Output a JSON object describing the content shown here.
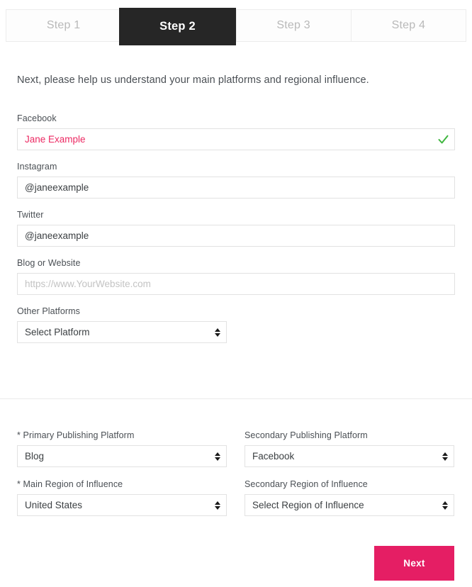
{
  "stepper": {
    "tabs": [
      {
        "label": "Step 1",
        "active": false
      },
      {
        "label": "Step 2",
        "active": true
      },
      {
        "label": "Step 3",
        "active": false
      },
      {
        "label": "Step 4",
        "active": false
      }
    ],
    "active_label": "Step 2",
    "active_color": "#262626",
    "inactive_text_color": "#b9b9b9"
  },
  "main": {
    "intro": "Next, please help us understand your main platforms and regional influence.",
    "fields": {
      "facebook": {
        "label": "Facebook",
        "value": "Jane Example",
        "placeholder": "",
        "valid": true,
        "value_color": "#ec2a63",
        "check_icon": "check-icon",
        "check_color": "#3fb63f"
      },
      "instagram": {
        "label": "Instagram",
        "value": "@janeexample",
        "placeholder": ""
      },
      "twitter": {
        "label": "Twitter",
        "value": "@janeexample",
        "placeholder": ""
      },
      "website": {
        "label": "Blog or Website",
        "value": "",
        "placeholder": "https://www.YourWebsite.com"
      },
      "other_platforms": {
        "label": "Other Platforms",
        "value": "Select Platform",
        "icon": "chevron-updown-icon"
      }
    }
  },
  "bottom": {
    "primary_platform": {
      "label": "* Primary Publishing Platform",
      "value": "Blog",
      "icon": "chevron-updown-icon"
    },
    "secondary_platform": {
      "label": "Secondary Publishing Platform",
      "value": "Facebook",
      "icon": "chevron-updown-icon"
    },
    "main_region": {
      "label": "* Main Region of Influence",
      "value": "United States",
      "icon": "chevron-updown-icon"
    },
    "secondary_region": {
      "label": "Secondary Region of Influence",
      "value": "Select Region of Influence",
      "icon": "chevron-updown-icon"
    }
  },
  "footer": {
    "next_label": "Next",
    "next_color": "#e51e64"
  }
}
